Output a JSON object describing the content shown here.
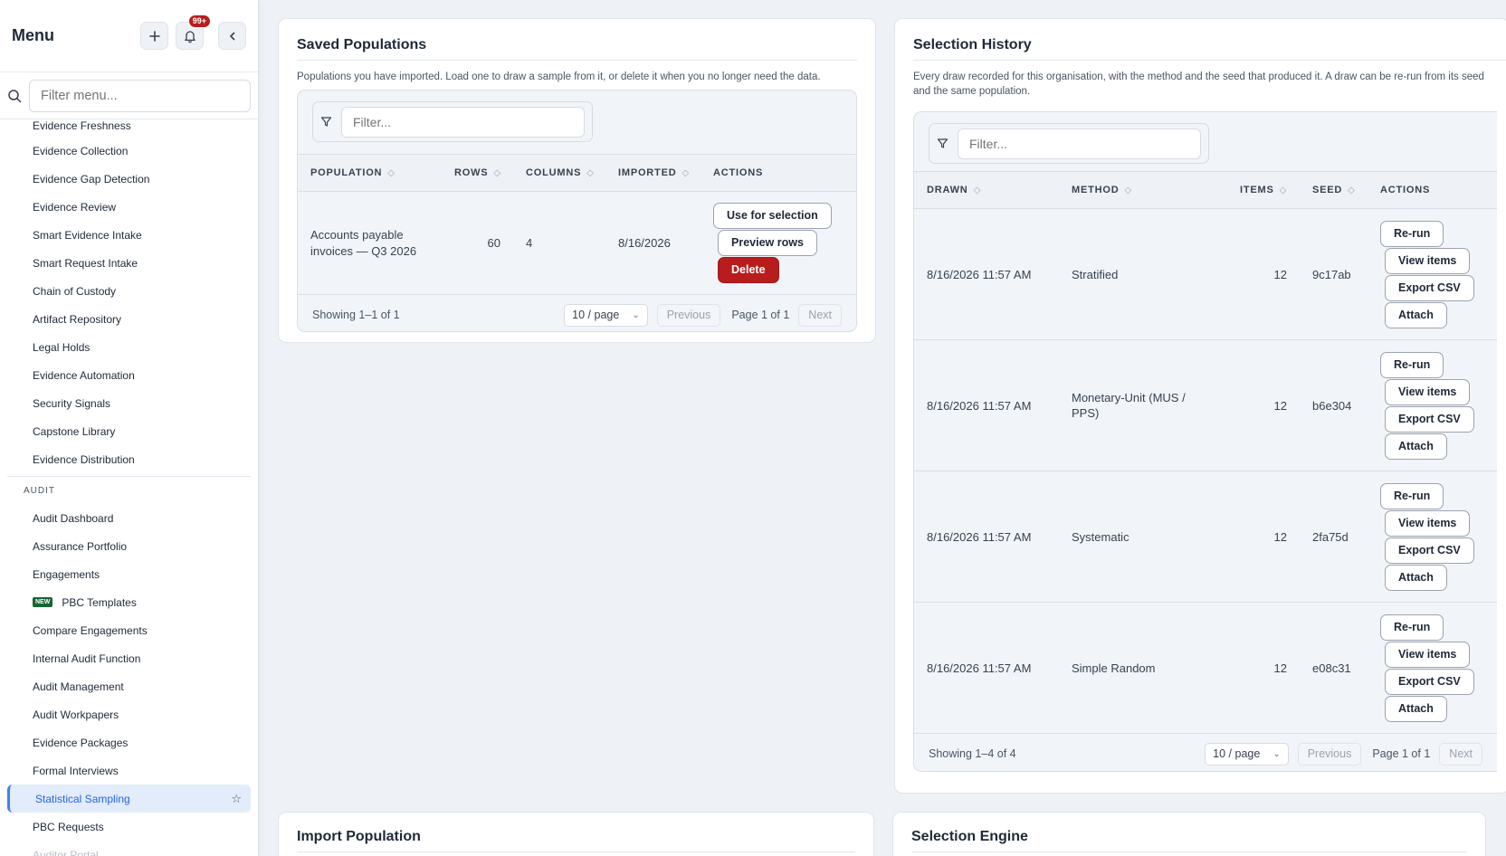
{
  "sidebar": {
    "title": "Menu",
    "notification_count": "99+",
    "search_placeholder": "Filter menu...",
    "evidence_items": [
      "Evidence Freshness",
      "Evidence Collection",
      "Evidence Gap Detection",
      "Evidence Review",
      "Smart Evidence Intake",
      "Smart Request Intake",
      "Chain of Custody",
      "Artifact Repository",
      "Legal Holds",
      "Evidence Automation",
      "Security Signals",
      "Capstone Library",
      "Evidence Distribution"
    ],
    "audit_section_label": "AUDIT",
    "audit_items": {
      "i0": "Audit Dashboard",
      "i1": "Assurance Portfolio",
      "i2": "Engagements",
      "i3": "PBC Templates",
      "i3_tag": "NEW",
      "i4": "Compare Engagements",
      "i5": "Internal Audit Function",
      "i6": "Audit Management",
      "i7": "Audit Workpapers",
      "i8": "Evidence Packages",
      "i9": "Formal Interviews",
      "i10": "Statistical Sampling",
      "i11": "PBC Requests",
      "i12": "Auditor Portal"
    }
  },
  "saved_populations": {
    "title": "Saved Populations",
    "description": "Populations you have imported. Load one to draw a sample from it, or delete it when you no longer need the data.",
    "filter_placeholder": "Filter...",
    "columns": [
      "POPULATION",
      "ROWS",
      "COLUMNS",
      "IMPORTED",
      "ACTIONS"
    ],
    "rows": [
      {
        "population_line1": "Accounts payable",
        "population_line2": "invoices — Q3 2026",
        "rows": "60",
        "columns": "4",
        "imported": "8/16/2026",
        "actions": [
          "Use for selection",
          "Preview rows",
          "Delete"
        ]
      }
    ],
    "footer": {
      "showing": "Showing 1–1 of 1",
      "page_size": "10 / page",
      "previous": "Previous",
      "page": "Page 1 of 1",
      "next": "Next"
    }
  },
  "selection_history": {
    "title": "Selection History",
    "description": "Every draw recorded for this organisation, with the method and the seed that produced it. A draw can be re-run from its seed and the same population.",
    "filter_placeholder": "Filter...",
    "columns": [
      "DRAWN",
      "METHOD",
      "ITEMS",
      "SEED",
      "ACTIONS"
    ],
    "action_labels": [
      "Re-run",
      "View items",
      "Export CSV",
      "Attach"
    ],
    "rows": [
      {
        "drawn": "8/16/2026 11:57 AM",
        "method_line1": "Stratified",
        "method_line2": "",
        "items": "12",
        "seed": "9c17ab"
      },
      {
        "drawn": "8/16/2026 11:57 AM",
        "method_line1": "Monetary-Unit (MUS /",
        "method_line2": "PPS)",
        "items": "12",
        "seed": "b6e304"
      },
      {
        "drawn": "8/16/2026 11:57 AM",
        "method_line1": "Systematic",
        "method_line2": "",
        "items": "12",
        "seed": "2fa75d"
      },
      {
        "drawn": "8/16/2026 11:57 AM",
        "method_line1": "Simple Random",
        "method_line2": "",
        "items": "12",
        "seed": "e08c31"
      }
    ],
    "footer": {
      "showing": "Showing 1–4 of 4",
      "page_size": "10 / page",
      "previous": "Previous",
      "page": "Page 1 of 1",
      "next": "Next"
    }
  },
  "import_population": {
    "title": "Import Population"
  },
  "selection_engine": {
    "title": "Selection Engine"
  }
}
